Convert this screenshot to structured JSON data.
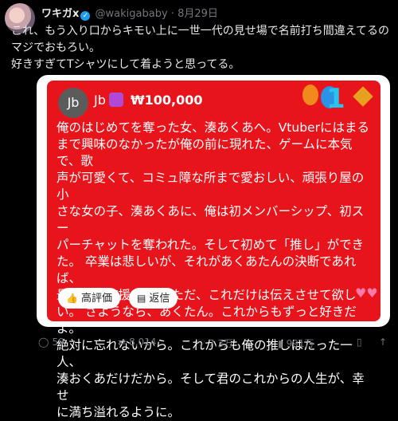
{
  "post": {
    "display_name": "ワキガx",
    "handle": "@wakigababy",
    "date": "8月29日",
    "text_lines": [
      "これ、もう入り口からキモい上に一世一代の見せ場で名前打ち間違えてるの",
      "マジでおもろい。",
      "好きすぎてTシャツにして着ようと思ってる。"
    ]
  },
  "superchat": {
    "avatar_initials": "Jb",
    "username": "Jb",
    "amount": "₩100,000",
    "message_lines": [
      "俺のはじめてを奪った女、湊あくあへ。Vtuberにはまる",
      "まで興味のなかったが俺の前に現れた、ゲームに本気で、歌",
      "声が可愛くて、コミュ障な所まで愛おしい、頑張り屋の小",
      "さな女の子、湊あくあに、俺は初メンバーシップ、初スー",
      "パーチャットを奪われた。そして初めて「推し」ができ",
      "た。 卒業は悲しいが、それがあくあたんの決断であれば、",
      "最後まで応援する。 ただ、これだけは伝えさせて欲し",
      "い。 さようなら、あくたん。これからもずっと好きだよ。",
      "絶対に忘れないから。これからも俺の推しはたった一人、",
      "湊おくあだけだから。そして君のこれからの人生が、幸せ",
      "に満ち溢れるように。"
    ],
    "like_label": "高評価",
    "reply_label": "返信"
  },
  "actions": {
    "replies": "59",
    "reposts": "8,014",
    "likes": "7.3万",
    "views": "991万"
  },
  "colors": {
    "superchat_bg": "#e8141b",
    "background": "#000000",
    "muted": "#71767b"
  }
}
